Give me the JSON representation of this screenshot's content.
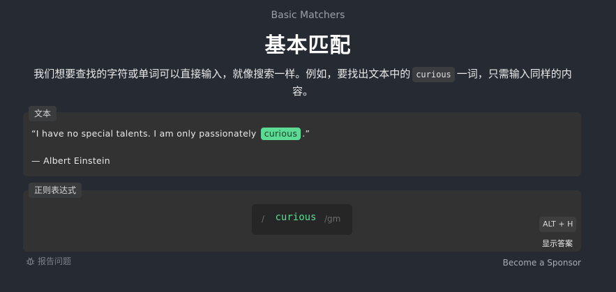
{
  "header": {
    "subtitle": "Basic Matchers",
    "title": "基本匹配"
  },
  "description": {
    "before": "我们想要查找的字符或单词可以直接输入，就像搜索一样。例如，要找出文本中的",
    "code": "curious",
    "after": "一词，只需输入同样的内容。"
  },
  "text_section": {
    "label": "文本",
    "quote_before": "“I have no special talents. I am only passionately",
    "match": "curious",
    "quote_after": ".”",
    "author": "— Albert Einstein"
  },
  "regex_section": {
    "label": "正则表达式",
    "slash": "/",
    "value": "curious",
    "flags": "/gm",
    "shortcut": "ALT + H",
    "show_answer": "显示答案"
  },
  "footer": {
    "report": "报告问题",
    "sponsor": "Become a Sponsor"
  },
  "colors": {
    "background": "#262a33",
    "panel": "#323232",
    "match": "#5cdb95"
  }
}
